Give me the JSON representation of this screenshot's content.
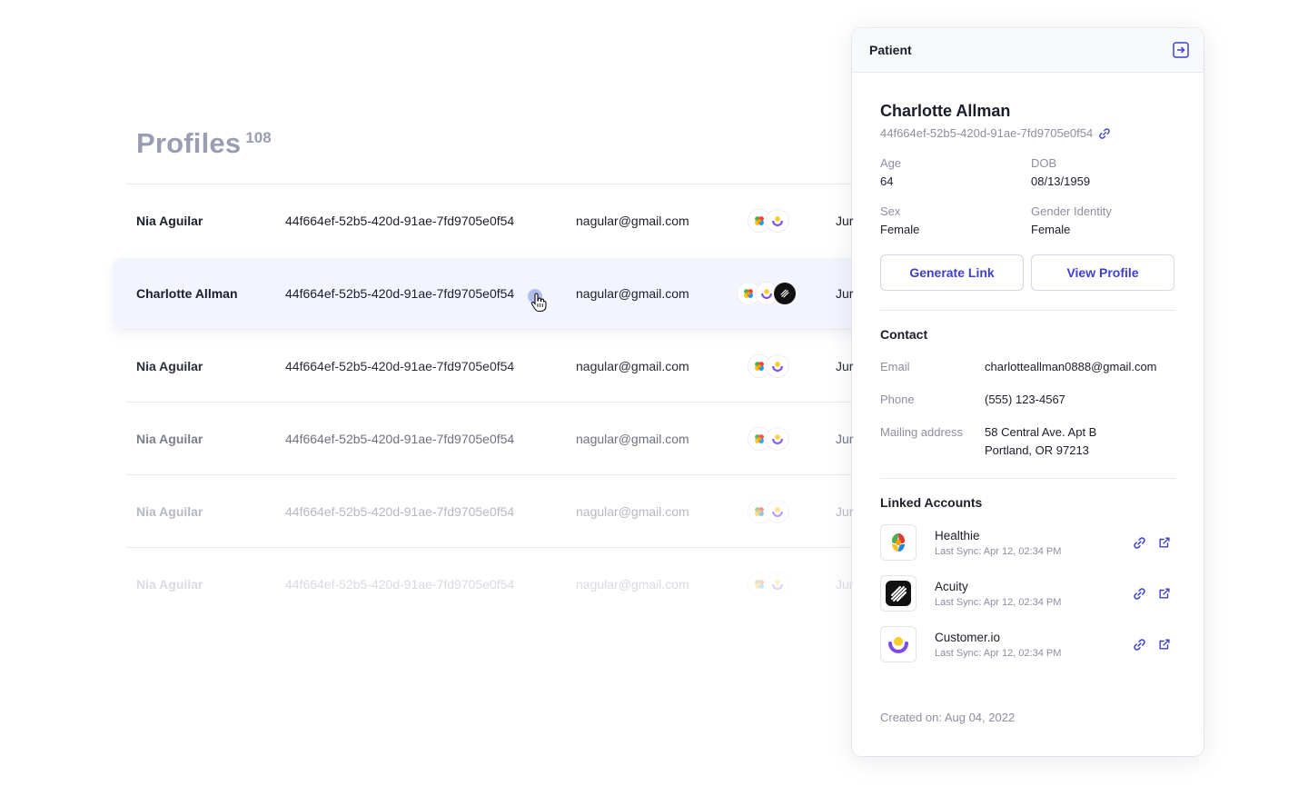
{
  "profiles": {
    "title": "Profiles",
    "count": "108",
    "rows": [
      {
        "name": "Nia Aguilar",
        "id": "44f664ef-52b5-420d-91ae-7fd9705e0f54",
        "email": "nagular@gmail.com",
        "date": "Jur"
      },
      {
        "name": "Charlotte Allman",
        "id": "44f664ef-52b5-420d-91ae-7fd9705e0f54",
        "email": "nagular@gmail.com",
        "date": "Jur"
      },
      {
        "name": "Nia Aguilar",
        "id": "44f664ef-52b5-420d-91ae-7fd9705e0f54",
        "email": "nagular@gmail.com",
        "date": "Jur"
      },
      {
        "name": "Nia Aguilar",
        "id": "44f664ef-52b5-420d-91ae-7fd9705e0f54",
        "email": "nagular@gmail.com",
        "date": "Jur"
      },
      {
        "name": "Nia Aguilar",
        "id": "44f664ef-52b5-420d-91ae-7fd9705e0f54",
        "email": "nagular@gmail.com",
        "date": "Jur"
      },
      {
        "name": "Nia Aguilar",
        "id": "44f664ef-52b5-420d-91ae-7fd9705e0f54",
        "email": "nagular@gmail.com",
        "date": "Jur"
      }
    ]
  },
  "panel": {
    "title": "Patient",
    "collapse_icon": "collapse-panel-icon",
    "patient": {
      "name": "Charlotte Allman",
      "id": "44f664ef-52b5-420d-91ae-7fd9705e0f54",
      "age_label": "Age",
      "age": "64",
      "dob_label": "DOB",
      "dob": "08/13/1959",
      "sex_label": "Sex",
      "sex": "Female",
      "gender_label": "Gender Identity",
      "gender": "Female"
    },
    "buttons": {
      "generate_link": "Generate Link",
      "view_profile": "View Profile"
    },
    "contact": {
      "title": "Contact",
      "email_label": "Email",
      "email": "charlotteallman0888@gmail.com",
      "phone_label": "Phone",
      "phone": "(555) 123-4567",
      "address_label": "Mailing address",
      "address_line1": "58 Central Ave. Apt B",
      "address_line2": "Portland, OR 97213"
    },
    "linked_accounts": {
      "title": "Linked Accounts",
      "items": [
        {
          "name": "Healthie",
          "sync": "Last Sync: Apr 12, 02:34 PM"
        },
        {
          "name": "Acuity",
          "sync": "Last Sync: Apr 12, 02:34 PM"
        },
        {
          "name": "Customer.io",
          "sync": "Last Sync: Apr 12, 02:34 PM"
        }
      ]
    },
    "created": "Created on: Aug 04, 2022"
  },
  "colors": {
    "accent": "#3c3fd0",
    "muted_text": "#8d8fa0",
    "title_gray": "#9a9cb1",
    "selected_row_bg": "#f2f5fd"
  }
}
